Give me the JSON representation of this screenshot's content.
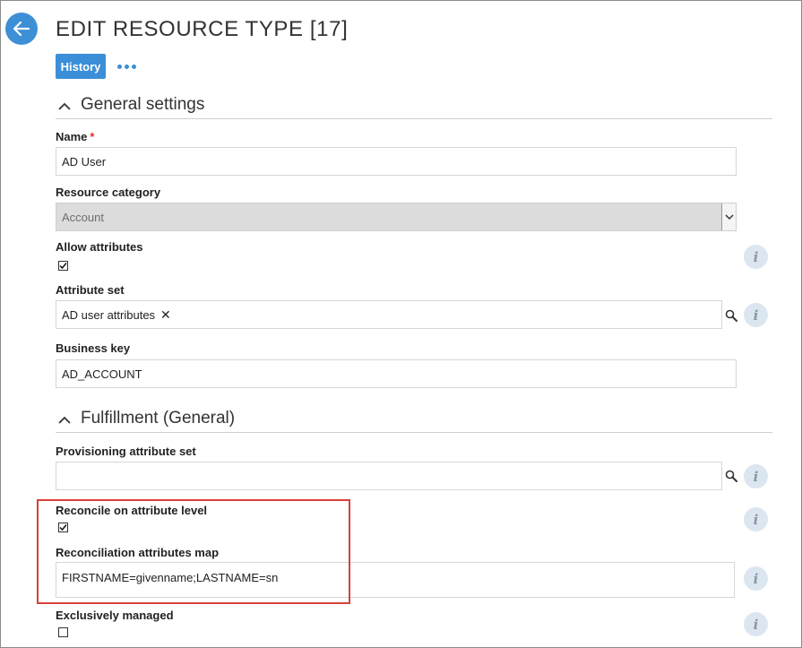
{
  "header": {
    "title": "EDIT RESOURCE TYPE [17]",
    "history_label": "History"
  },
  "sections": {
    "general": {
      "title": "General settings",
      "name": {
        "label": "Name",
        "required_mark": "*",
        "value": "AD User"
      },
      "resource_category": {
        "label": "Resource category",
        "value": "Account"
      },
      "allow_attributes": {
        "label": "Allow attributes",
        "checked": true
      },
      "attribute_set": {
        "label": "Attribute set",
        "chip": "AD user attributes",
        "remove_glyph": "✕"
      },
      "business_key": {
        "label": "Business key",
        "value": "AD_ACCOUNT"
      }
    },
    "fulfillment": {
      "title": "Fulfillment (General)",
      "provisioning_attribute_set": {
        "label": "Provisioning attribute set",
        "value": ""
      },
      "reconcile_on_attribute_level": {
        "label": "Reconcile on attribute level",
        "checked": true
      },
      "reconciliation_attributes_map": {
        "label": "Reconciliation attributes map",
        "value": "FIRSTNAME=givenname;LASTNAME=sn"
      },
      "exclusively_managed": {
        "label": "Exclusively managed",
        "checked": false
      }
    }
  },
  "info_glyph": "i",
  "colors": {
    "accent": "#3b8fd8",
    "highlight": "#d9403a",
    "info_bg": "#dce6f1"
  },
  "icons": [
    "arrow-left-icon",
    "more-dots-icon",
    "chevron-up-icon",
    "search-icon",
    "info-icon",
    "checkmark-icon"
  ]
}
